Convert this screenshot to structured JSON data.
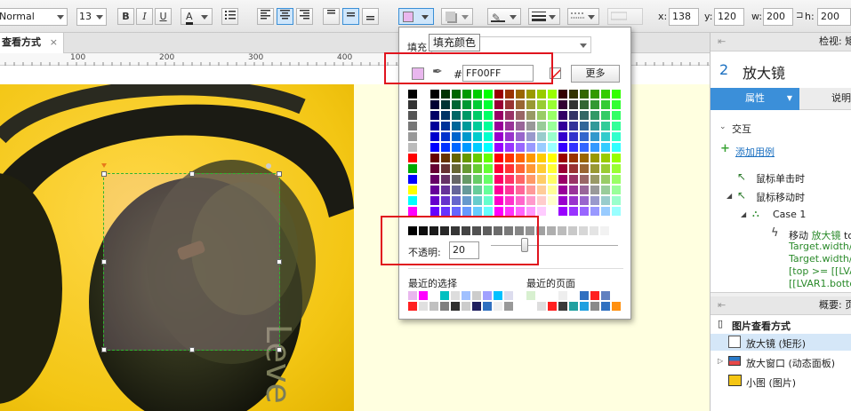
{
  "toolbar": {
    "font_style": "Normal",
    "font_size": "13",
    "bold": "B",
    "italic": "I",
    "underline": "U",
    "font_color": "A",
    "x_label": "x:",
    "x_value": "138",
    "y_label": "y:",
    "y_value": "120",
    "w_label": "w:",
    "w_value": "200",
    "h_label": "h:",
    "h_value": "200"
  },
  "tab": {
    "title": "查看方式",
    "close": "×"
  },
  "ruler": {
    "ticks": [
      "100",
      "200",
      "300",
      "400"
    ]
  },
  "picker": {
    "tooltip": "填充颜色",
    "fill_label": "填充",
    "hash": "#",
    "hex_value": "FF00FF",
    "more_button": "更多",
    "opacity_label": "不透明:",
    "opacity_value": "20",
    "recent_label": "最近的选择",
    "page_label": "最近的页面",
    "selected_color": "#e9b7ee"
  },
  "right_panel": {
    "header_title": "检视: 矩",
    "number": "2",
    "shape_name": "放大镜",
    "tab_properties": "属性",
    "tab_notes": "说明",
    "interaction": "交互",
    "add_case": "添加用例",
    "event_click": "鼠标单击时",
    "event_move": "鼠标移动时",
    "case": "Case 1",
    "action_move": "移动",
    "action_target": "放大镜",
    "action_to": "to",
    "line2": "Target.width/2]",
    "line3": "Target.width/2]",
    "line4": "[top >= [[LVAR",
    "line5": "[[LVAR1.bottom",
    "outline_header": "概要: 页",
    "outline_page": "图片查看方式",
    "outline_item1": "放大镜 (矩形)",
    "outline_item2": "放大窗口 (动态面板)",
    "outline_item3": "小图 (图片)"
  }
}
